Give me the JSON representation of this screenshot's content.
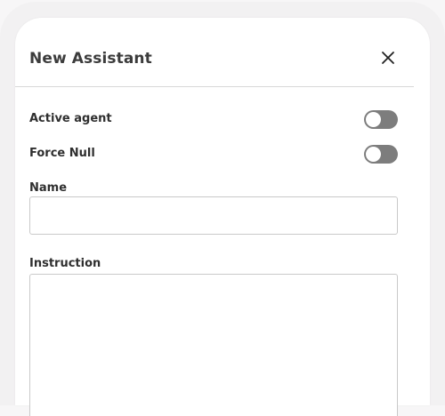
{
  "modal": {
    "title": "New Assistant"
  },
  "icons": {
    "close": "close-icon"
  },
  "toggles": [
    {
      "label": "Active agent",
      "on": false
    },
    {
      "label": "Force Null",
      "on": false
    }
  ],
  "fields": {
    "name": {
      "label": "Name",
      "value": "",
      "placeholder": ""
    },
    "instruction": {
      "label": "Instruction",
      "value": "",
      "placeholder": ""
    }
  },
  "colors": {
    "toggle_off": "#7d7d7d",
    "title_text": "#3c3c3c",
    "border": "#c9c9c9"
  }
}
